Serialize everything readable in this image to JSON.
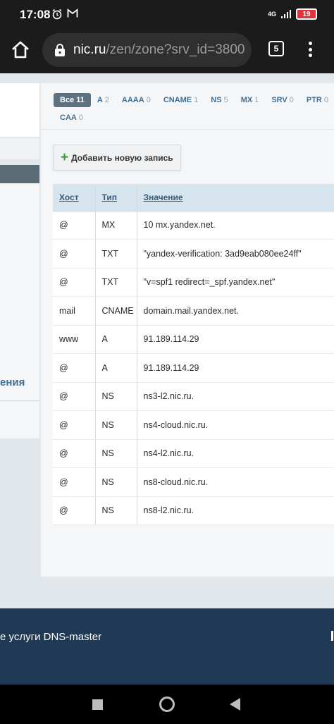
{
  "status_bar": {
    "time": "17:08",
    "network": "4G",
    "battery": "19"
  },
  "browser": {
    "url_host": "nic.ru",
    "url_path": "/zen/zone?srv_id=3800",
    "tab_count": "5"
  },
  "sidebar": {
    "partial_link": "ения"
  },
  "filters": [
    {
      "label": "Все",
      "count": "11",
      "active": true
    },
    {
      "label": "A",
      "count": "2"
    },
    {
      "label": "AAAA",
      "count": "0"
    },
    {
      "label": "CNAME",
      "count": "1"
    },
    {
      "label": "NS",
      "count": "5"
    },
    {
      "label": "MX",
      "count": "1"
    },
    {
      "label": "SRV",
      "count": "0"
    },
    {
      "label": "PTR",
      "count": "0"
    },
    {
      "label": "CAA",
      "count": "0"
    }
  ],
  "add_button": {
    "label": "Добавить новую запись"
  },
  "table": {
    "headers": [
      "Хост",
      "Тип",
      "Значение"
    ],
    "rows": [
      [
        "@",
        "MX",
        "10 mx.yandex.net."
      ],
      [
        "@",
        "TXT",
        "\"yandex-verification: 3ad9eab080ee24ff\""
      ],
      [
        "@",
        "TXT",
        "\"v=spf1 redirect=_spf.yandex.net\""
      ],
      [
        "mail",
        "CNAME",
        "domain.mail.yandex.net."
      ],
      [
        "www",
        "A",
        "91.189.114.29"
      ],
      [
        "@",
        "A",
        "91.189.114.29"
      ],
      [
        "@",
        "NS",
        "ns3-l2.nic.ru."
      ],
      [
        "@",
        "NS",
        "ns4-cloud.nic.ru."
      ],
      [
        "@",
        "NS",
        "ns4-l2.nic.ru."
      ],
      [
        "@",
        "NS",
        "ns8-cloud.nic.ru."
      ],
      [
        "@",
        "NS",
        "ns8-l2.nic.ru."
      ]
    ]
  },
  "footer": {
    "text": "е услуги DNS-master"
  },
  "colors": {
    "accent": "#3f6f95",
    "active_filter": "#5c7280",
    "table_header": "#d6e4ee",
    "footer": "#203a55",
    "plus_green": "#3d9a3d"
  }
}
